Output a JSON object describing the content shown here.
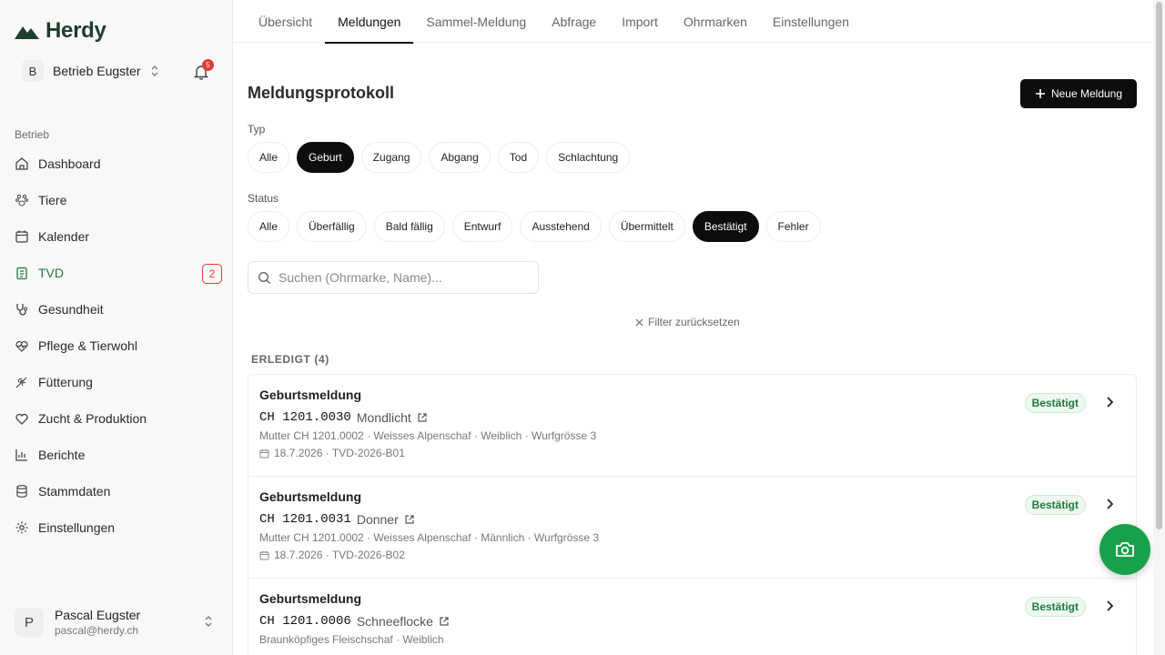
{
  "app": {
    "logo_text": "Herdy",
    "farm_initial": "B",
    "farm_name": "Betrieb Eugster",
    "notification_count": "5"
  },
  "sidebar": {
    "section_label": "Betrieb",
    "items": [
      {
        "label": "Dashboard",
        "icon": "home-icon"
      },
      {
        "label": "Tiere",
        "icon": "paw-icon"
      },
      {
        "label": "Kalender",
        "icon": "calendar-icon"
      },
      {
        "label": "TVD",
        "icon": "clipboard-icon",
        "count": "2",
        "active": true
      },
      {
        "label": "Gesundheit",
        "icon": "stethoscope-icon"
      },
      {
        "label": "Pflege & Tierwohl",
        "icon": "heart-pulse-icon"
      },
      {
        "label": "Fütterung",
        "icon": "wheat-icon"
      },
      {
        "label": "Zucht & Produktion",
        "icon": "heart-icon"
      },
      {
        "label": "Berichte",
        "icon": "bar-chart-icon"
      },
      {
        "label": "Stammdaten",
        "icon": "database-icon"
      },
      {
        "label": "Einstellungen",
        "icon": "gear-icon"
      }
    ],
    "user": {
      "initial": "P",
      "name": "Pascal Eugster",
      "email": "pascal@herdy.ch"
    }
  },
  "tabs": [
    "Übersicht",
    "Meldungen",
    "Sammel-Meldung",
    "Abfrage",
    "Import",
    "Ohrmarken",
    "Einstellungen"
  ],
  "active_tab": "Meldungen",
  "main": {
    "title": "Meldungsprotokoll",
    "new_button": "Neue Meldung",
    "type_label": "Typ",
    "type_chips": [
      "Alle",
      "Geburt",
      "Zugang",
      "Abgang",
      "Tod",
      "Schlachtung"
    ],
    "type_selected": "Geburt",
    "status_label": "Status",
    "status_chips": [
      "Alle",
      "Überfällig",
      "Bald fällig",
      "Entwurf",
      "Ausstehend",
      "Übermittelt",
      "Bestätigt",
      "Fehler"
    ],
    "status_selected": "Bestätigt",
    "search_placeholder": "Suchen (Ohrmarke, Name)...",
    "reset_label": "Filter zurücksetzen",
    "group_title": "ERLEDIGT (4)"
  },
  "reports": [
    {
      "title": "Geburtsmeldung",
      "tag": "CH 1201.0030",
      "name": "Mondlicht",
      "meta": "Mutter CH 1201.0002 · Weisses Alpenschaf · Weiblich · Wurfgrösse 3",
      "date": "18.7.2026 · TVD-2026-B01",
      "status": "Bestätigt"
    },
    {
      "title": "Geburtsmeldung",
      "tag": "CH 1201.0031",
      "name": "Donner",
      "meta": "Mutter CH 1201.0002 · Weisses Alpenschaf · Männlich · Wurfgrösse 3",
      "date": "18.7.2026 · TVD-2026-B02",
      "status": "Bestätigt"
    },
    {
      "title": "Geburtsmeldung",
      "tag": "CH 1201.0006",
      "name": "Schneeflocke",
      "meta": "Braunköpfiges Fleischschaf · Weiblich",
      "date": "",
      "status": "Bestätigt"
    }
  ],
  "colors": {
    "brand": "#1f3d2c",
    "accent": "#18a14a",
    "confirmed": "#1e7a3c",
    "alert": "#e53935"
  }
}
